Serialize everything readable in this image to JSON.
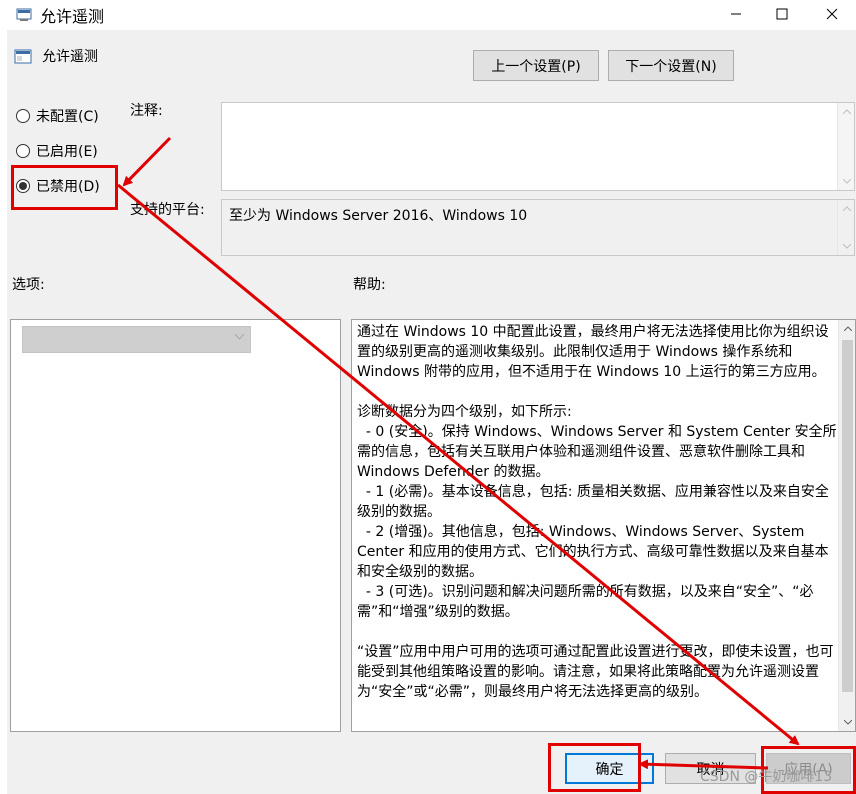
{
  "window": {
    "title": "允许遥测"
  },
  "header": {
    "title": "允许遥测",
    "prev_label": "上一个设置(P)",
    "next_label": "下一个设置(N)"
  },
  "state": {
    "options": [
      {
        "label": "未配置(C)",
        "checked": false
      },
      {
        "label": "已启用(E)",
        "checked": false
      },
      {
        "label": "已禁用(D)",
        "checked": true
      }
    ]
  },
  "comment": {
    "label": "注释:",
    "value": ""
  },
  "platform": {
    "label": "支持的平台:",
    "value": "至少为 Windows Server 2016、Windows 10"
  },
  "options_pane": {
    "label": "选项:"
  },
  "help_pane": {
    "label": "帮助:",
    "text": "通过在 Windows 10 中配置此设置，最终用户将无法选择使用比你为组织设置的级别更高的遥测收集级别。此限制仅适用于 Windows 操作系统和 Windows 附带的应用，但不适用于在 Windows 10 上运行的第三方应用。\n\n诊断数据分为四个级别，如下所示:\n  - 0 (安全)。保持 Windows、Windows Server 和 System Center 安全所需的信息，包括有关互联用户体验和遥测组件设置、恶意软件删除工具和 Windows Defender 的数据。\n  - 1 (必需)。基本设备信息，包括: 质量相关数据、应用兼容性以及来自安全级别的数据。\n  - 2 (增强)。其他信息，包括: Windows、Windows Server、System Center 和应用的使用方式、它们的执行方式、高级可靠性数据以及来自基本和安全级别的数据。\n  - 3 (可选)。识别问题和解决问题所需的所有数据，以及来自“安全”、“必需”和“增强”级别的数据。\n\n“设置”应用中用户可用的选项可通过配置此设置进行更改，即使未设置，也可能受到其他组策略设置的影响。请注意，如果将此策略配置为允许遥测设置为“安全”或“必需”，则最终用户将无法选择更高的级别。"
  },
  "footer": {
    "ok_label": "确定",
    "cancel_label": "取消",
    "apply_label": "应用(A)"
  },
  "watermark": "CSDN @牛奶咖啡13",
  "colors": {
    "annotation": "#e00000",
    "focus": "#0078d7"
  },
  "icons": [
    "policy-icon",
    "minimize-icon",
    "maximize-icon",
    "close-icon",
    "chevron-down-icon",
    "chevron-up-icon"
  ]
}
